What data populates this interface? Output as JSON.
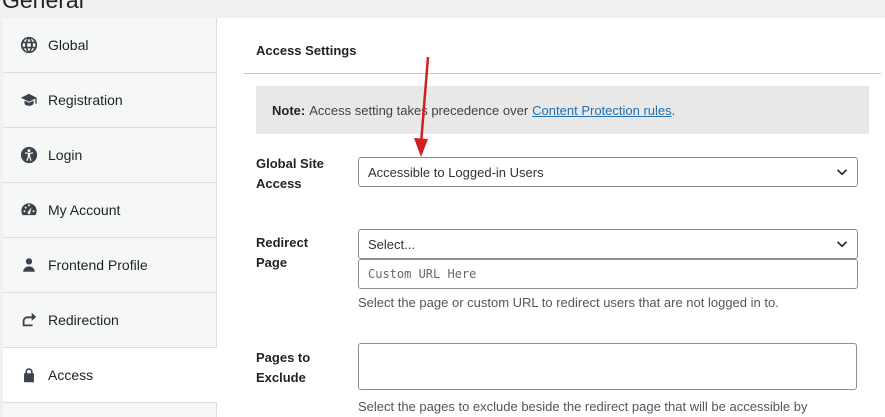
{
  "page": {
    "heading": "General"
  },
  "sidebar": {
    "items": [
      {
        "label": "Global",
        "icon": "globe-icon"
      },
      {
        "label": "Registration",
        "icon": "graduation-cap-icon"
      },
      {
        "label": "Login",
        "icon": "person-icon"
      },
      {
        "label": "My Account",
        "icon": "dashboard-icon"
      },
      {
        "label": "Frontend Profile",
        "icon": "user-icon"
      },
      {
        "label": "Redirection",
        "icon": "redirect-arrow-icon"
      },
      {
        "label": "Access",
        "icon": "lock-icon",
        "active": true
      }
    ]
  },
  "main": {
    "section_title": "Access Settings",
    "notice": {
      "label": "Note:",
      "text": "Access setting takes precedence over",
      "link_text": "Content Protection rules",
      "end": "."
    },
    "global_site_access": {
      "label_line1": "Global Site",
      "label_line2": "Access",
      "value": "Accessible to Logged-in Users"
    },
    "redirect_page": {
      "label_line1": "Redirect",
      "label_line2": "Page",
      "select_value": "Select...",
      "custom_url_placeholder": "Custom URL Here",
      "description": "Select the page or custom URL to redirect users that are not logged in to."
    },
    "pages_to_exclude": {
      "label_line1": "Pages to",
      "label_line2": "Exclude",
      "description": "Select the pages to exclude beside the redirect page that will be accessible by"
    }
  },
  "colors": {
    "accent_link": "#2271b1",
    "annotation_arrow": "#d0201f",
    "notice_bg": "#e8e8e8"
  }
}
